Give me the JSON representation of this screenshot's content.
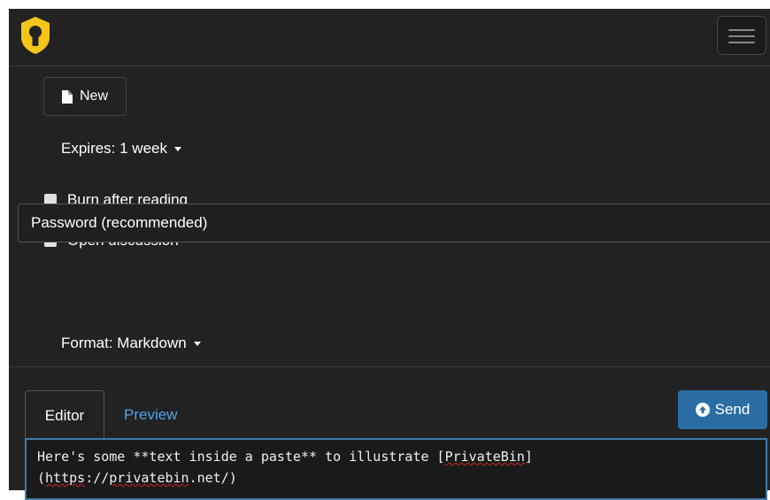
{
  "navbar": {
    "logo_icon": "keyhole-shield-icon",
    "menu_icon": "hamburger-menu-icon"
  },
  "toolbar": {
    "new_label": "New",
    "new_icon": "file-icon",
    "expires_label": "Expires: 1 week",
    "burn_label": "Burn after reading",
    "discussion_label": "Open discussion",
    "password_placeholder": "Password (recommended)",
    "format_label": "Format: Markdown"
  },
  "editor": {
    "tab_editor": "Editor",
    "tab_preview": "Preview",
    "send_label": "Send",
    "send_icon": "circle-arrow-up-icon",
    "text_line1_a": "Here's some **text inside a paste** to illustrate [",
    "text_line1_b": "PrivateBin",
    "text_line1_c": "]",
    "text_line2_a": "(",
    "text_line2_b": "https",
    "text_line2_c": "://",
    "text_line2_d": "privatebin",
    "text_line2_e": ".net/)"
  },
  "colors": {
    "background": "#222222",
    "link": "#4fa3e8",
    "send_button": "#2a6da3",
    "logo_yellow": "#f5c518"
  }
}
